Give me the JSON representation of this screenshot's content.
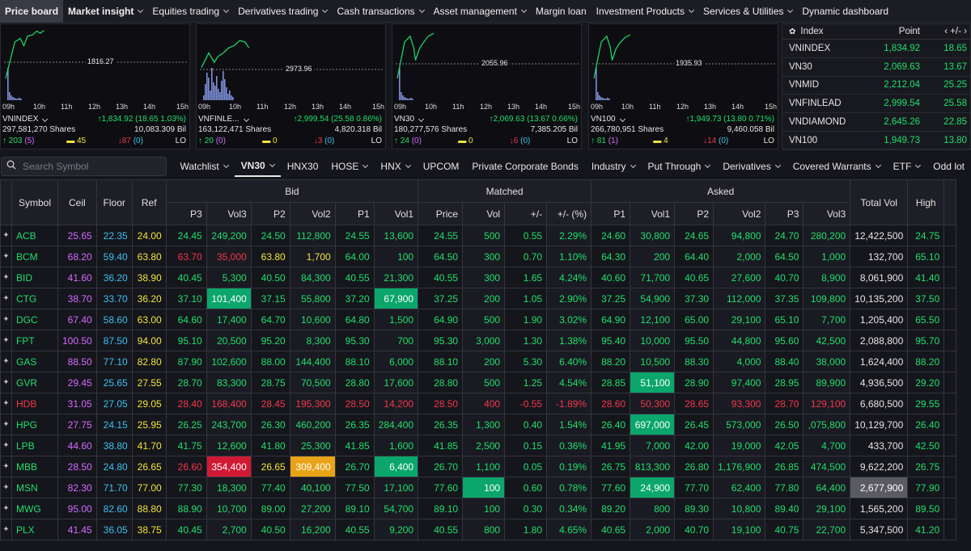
{
  "nav": {
    "items": [
      {
        "label": "Price board",
        "active": true,
        "chevron": false
      },
      {
        "label": "Market insight",
        "active": false,
        "chevron": true,
        "bold": true
      },
      {
        "label": "Equities trading",
        "chevron": true
      },
      {
        "label": "Derivatives trading",
        "chevron": true
      },
      {
        "label": "Cash transactions",
        "chevron": true
      },
      {
        "label": "Asset management",
        "chevron": true
      },
      {
        "label": "Margin loan",
        "chevron": false
      },
      {
        "label": "Investment Products",
        "chevron": true
      },
      {
        "label": "Services & Utilities",
        "chevron": true
      },
      {
        "label": "Dynamic dashboard",
        "chevron": false
      }
    ]
  },
  "panels": [
    {
      "name": "VNINDEX",
      "ref": "1816.27",
      "change": "1,834.92 (18.65 1.03%)",
      "shares": "297,581,270 Shares",
      "value": "10,083.309 Bil",
      "up": "203",
      "up_ceil": "(5)",
      "flat": "45",
      "down": "87",
      "down_floor": "(0)",
      "status": "LO",
      "times": [
        "09h",
        "10h",
        "11h",
        "12h",
        "13h",
        "14h",
        "15h"
      ]
    },
    {
      "name": "VNFINLE...",
      "ref": "2973.96",
      "change": "2,999.54 (25.58 0.86%)",
      "shares": "163,122,471 Shares",
      "value": "4,820.318 Bil",
      "up": "20",
      "up_ceil": "(0)",
      "flat": "0",
      "down": "3",
      "down_floor": "(0)",
      "status": "LO",
      "times": [
        "09h",
        "10h",
        "11h",
        "12h",
        "13h",
        "14h",
        "15h"
      ]
    },
    {
      "name": "VN30",
      "ref": "2055.96",
      "change": "2,069.63 (13.67 0.66%)",
      "shares": "180,277,576 Shares",
      "value": "7,385.205 Bil",
      "up": "24",
      "up_ceil": "(0)",
      "flat": "0",
      "down": "6",
      "down_floor": "(0)",
      "status": "LO",
      "times": [
        "09h",
        "10h",
        "11h",
        "12h",
        "13h",
        "14h",
        "15h"
      ]
    },
    {
      "name": "VN100",
      "ref": "1935.93",
      "change": "1,949.73 (13.80 0.71%)",
      "shares": "266,780,951 Shares",
      "value": "9,460.058 Bil",
      "up": "81",
      "up_ceil": "(1)",
      "flat": "4",
      "down": "14",
      "down_floor": "(0)",
      "status": "LO",
      "times": [
        "09h",
        "10h",
        "11h",
        "12h",
        "13h",
        "14h",
        "15h"
      ]
    }
  ],
  "index_table": {
    "headers": {
      "index": "Index",
      "point": "Point",
      "change": "+/-"
    },
    "rows": [
      {
        "name": "VNINDEX",
        "point": "1,834.92",
        "change": "18.65"
      },
      {
        "name": "VN30",
        "point": "2,069.63",
        "change": "13.67"
      },
      {
        "name": "VNMID",
        "point": "2,212.04",
        "change": "25.25"
      },
      {
        "name": "VNFINLEAD",
        "point": "2,999.54",
        "change": "25.58"
      },
      {
        "name": "VNDIAMOND",
        "point": "2,645.26",
        "change": "22.85"
      },
      {
        "name": "VN100",
        "point": "1,949.73",
        "change": "13.80"
      }
    ]
  },
  "search": {
    "placeholder": "Search Symbol"
  },
  "tabs": [
    {
      "label": "Watchlist",
      "chevron": true
    },
    {
      "label": "VN30",
      "chevron": true,
      "active": true
    },
    {
      "label": "HNX30",
      "chevron": false
    },
    {
      "label": "HOSE",
      "chevron": true
    },
    {
      "label": "HNX",
      "chevron": true
    },
    {
      "label": "UPCOM",
      "chevron": false
    },
    {
      "label": "Private Corporate Bonds",
      "chevron": false
    },
    {
      "label": "Industry",
      "chevron": true
    },
    {
      "label": "Put Through",
      "chevron": true
    },
    {
      "label": "Derivatives",
      "chevron": true
    },
    {
      "label": "Covered Warrants",
      "chevron": true
    },
    {
      "label": "ETF",
      "chevron": true
    },
    {
      "label": "Odd lot",
      "chevron": false
    }
  ],
  "table": {
    "headers": {
      "symbol": "Symbol",
      "ceil": "Ceil",
      "floor": "Floor",
      "ref": "Ref",
      "bid": "Bid",
      "matched": "Matched",
      "asked": "Asked",
      "total": "Total Vol",
      "high": "High",
      "sub": [
        "P3",
        "Vol3",
        "P2",
        "Vol2",
        "P1",
        "Vol1",
        "Price",
        "Vol",
        "+/-",
        "+/- (%)",
        "P1",
        "Vol1",
        "P2",
        "Vol2",
        "P3",
        "Vol3"
      ]
    },
    "colors": {
      "up": "#1ee06d",
      "down": "#f2374b",
      "ref": "#f1e53a",
      "ceil": "#d36cff",
      "floor": "#38c3f0"
    },
    "rows": [
      {
        "sym": "ACB",
        "c": "up",
        "ceil": "25.65",
        "floor": "22.35",
        "ref": "24.00",
        "b3": "24.45",
        "bv3": "249,200",
        "b2": "24.50",
        "bv2": "112,800",
        "b1": "24.55",
        "bv1": "13,600",
        "mp": "24.55",
        "mv": "500",
        "ch": "0.55",
        "pct": "2.29%",
        "a1": "24.60",
        "av1": "30,800",
        "a2": "24.65",
        "av2": "94,800",
        "a3": "24.70",
        "av3": "280,200",
        "tv": "12,422,500",
        "hi": "24.75",
        "hl": {}
      },
      {
        "sym": "BCM",
        "c": "up",
        "ceil": "68.20",
        "floor": "59.40",
        "ref": "63.80",
        "b3": "63.70",
        "bv3": "35,000",
        "b2": "63.80",
        "bv2": "1,700",
        "b1": "64.00",
        "bv1": "100",
        "mp": "64.50",
        "mv": "300",
        "ch": "0.70",
        "pct": "1.10%",
        "a1": "64.30",
        "av1": "200",
        "a2": "64.40",
        "av2": "2,000",
        "a3": "64.50",
        "av3": "1,000",
        "tv": "132,700",
        "hi": "65.10",
        "cc": {
          "b3": "down",
          "bv3": "down",
          "b2": "ref",
          "bv2": "ref"
        },
        "hl": {}
      },
      {
        "sym": "BID",
        "c": "up",
        "ceil": "41.60",
        "floor": "36.20",
        "ref": "38.90",
        "b3": "40.45",
        "bv3": "5,300",
        "b2": "40.50",
        "bv2": "84,300",
        "b1": "40.55",
        "bv1": "21,300",
        "mp": "40.55",
        "mv": "300",
        "ch": "1.65",
        "pct": "4.24%",
        "a1": "40.60",
        "av1": "71,700",
        "a2": "40.65",
        "av2": "27,600",
        "a3": "40.70",
        "av3": "8,900",
        "tv": "8,061,900",
        "hi": "41.40",
        "hl": {}
      },
      {
        "sym": "CTG",
        "c": "up",
        "ceil": "38.70",
        "floor": "33.70",
        "ref": "36.20",
        "b3": "37.10",
        "bv3": "101,400",
        "b2": "37.15",
        "bv2": "55,800",
        "b1": "37.20",
        "bv1": "67,900",
        "mp": "37.25",
        "mv": "200",
        "ch": "1.05",
        "pct": "2.90%",
        "a1": "37.25",
        "av1": "54,900",
        "a2": "37.30",
        "av2": "112,000",
        "a3": "37.35",
        "av3": "109,800",
        "tv": "10,135,200",
        "hi": "37.50",
        "hl": {
          "bv3": "green",
          "bv1": "green"
        }
      },
      {
        "sym": "DGC",
        "c": "up",
        "ceil": "67.40",
        "floor": "58.60",
        "ref": "63.00",
        "b3": "64.60",
        "bv3": "17,400",
        "b2": "64.70",
        "bv2": "10,600",
        "b1": "64.80",
        "bv1": "1,500",
        "mp": "64.90",
        "mv": "500",
        "ch": "1.90",
        "pct": "3.02%",
        "a1": "64.90",
        "av1": "12,100",
        "a2": "65.00",
        "av2": "29,100",
        "a3": "65.10",
        "av3": "7,700",
        "tv": "1,205,400",
        "hi": "65.50",
        "hl": {}
      },
      {
        "sym": "FPT",
        "c": "up",
        "ceil": "100.50",
        "floor": "87.50",
        "ref": "94.00",
        "b3": "95.10",
        "bv3": "20,500",
        "b2": "95.20",
        "bv2": "8,300",
        "b1": "95.30",
        "bv1": "700",
        "mp": "95.30",
        "mv": "3,000",
        "ch": "1.30",
        "pct": "1.38%",
        "a1": "95.40",
        "av1": "10,000",
        "a2": "95.50",
        "av2": "44,800",
        "a3": "95.60",
        "av3": "42,500",
        "tv": "2,088,800",
        "hi": "95.70",
        "hl": {}
      },
      {
        "sym": "GAS",
        "c": "up",
        "ceil": "88.50",
        "floor": "77.10",
        "ref": "82.80",
        "b3": "87.90",
        "bv3": "102,600",
        "b2": "88.00",
        "bv2": "144,400",
        "b1": "88.10",
        "bv1": "6,000",
        "mp": "88.10",
        "mv": "200",
        "ch": "5.30",
        "pct": "6.40%",
        "a1": "88.20",
        "av1": "10,500",
        "a2": "88.30",
        "av2": "4,000",
        "a3": "88.40",
        "av3": "38,000",
        "tv": "1,624,400",
        "hi": "88.20",
        "hl": {}
      },
      {
        "sym": "GVR",
        "c": "up",
        "ceil": "29.45",
        "floor": "25.65",
        "ref": "27.55",
        "b3": "28.70",
        "bv3": "83,300",
        "b2": "28.75",
        "bv2": "70,500",
        "b1": "28.80",
        "bv1": "17,600",
        "mp": "28.80",
        "mv": "500",
        "ch": "1.25",
        "pct": "4.54%",
        "a1": "28.85",
        "av1": "51,100",
        "a2": "28.90",
        "av2": "97,400",
        "a3": "28.95",
        "av3": "89,900",
        "tv": "4,936,500",
        "hi": "29.20",
        "hl": {
          "av1": "green"
        }
      },
      {
        "sym": "HDB",
        "c": "down",
        "ceil": "31.05",
        "floor": "27.05",
        "ref": "29.05",
        "b3": "28.40",
        "bv3": "168,400",
        "b2": "28.45",
        "bv2": "195,300",
        "b1": "28.50",
        "bv1": "14,200",
        "mp": "28.50",
        "mv": "400",
        "ch": "-0.55",
        "pct": "-1.89%",
        "a1": "28.60",
        "av1": "50,300",
        "a2": "28.65",
        "av2": "93,300",
        "a3": "28.70",
        "av3": "129,100",
        "tv": "6,680,500",
        "hi": "29.55",
        "hl": {}
      },
      {
        "sym": "HPG",
        "c": "up",
        "ceil": "27.75",
        "floor": "24.15",
        "ref": "25.95",
        "b3": "26.25",
        "bv3": "243,700",
        "b2": "26.30",
        "bv2": "460,200",
        "b1": "26.35",
        "bv1": "284,400",
        "mp": "26.35",
        "mv": "1,300",
        "ch": "0.40",
        "pct": "1.54%",
        "a1": "26.40",
        "av1": "697,000",
        "a2": "26.45",
        "av2": "573,000",
        "a3": "26.50",
        "av3": ",075,800",
        "tv": "10,129,700",
        "hi": "26.40",
        "hl": {
          "av1": "green"
        }
      },
      {
        "sym": "LPB",
        "c": "up",
        "ceil": "44.60",
        "floor": "38.80",
        "ref": "41.70",
        "b3": "41.75",
        "bv3": "12,600",
        "b2": "41.80",
        "bv2": "25,300",
        "b1": "41.85",
        "bv1": "1,600",
        "mp": "41.85",
        "mv": "2,500",
        "ch": "0.15",
        "pct": "0.36%",
        "a1": "41.95",
        "av1": "7,000",
        "a2": "42.00",
        "av2": "19,000",
        "a3": "42.05",
        "av3": "4,700",
        "tv": "433,700",
        "hi": "42.50",
        "hl": {}
      },
      {
        "sym": "MBB",
        "c": "up",
        "ceil": "28.50",
        "floor": "24.80",
        "ref": "26.65",
        "b3": "26.60",
        "bv3": "354,400",
        "b2": "26.65",
        "bv2": "309,400",
        "b1": "26.70",
        "bv1": "6,400",
        "mp": "26.70",
        "mv": "1,100",
        "ch": "0.05",
        "pct": "0.19%",
        "a1": "26.75",
        "av1": "813,300",
        "a2": "26.80",
        "av2": "1,176,900",
        "a3": "26.85",
        "av3": "474,500",
        "tv": "9,622,200",
        "hi": "26.75",
        "cc": {
          "b3": "down",
          "b2": "ref"
        },
        "hl": {
          "bv3": "red",
          "bv2": "orange",
          "bv1": "green"
        }
      },
      {
        "sym": "MSN",
        "c": "up",
        "ceil": "82.30",
        "floor": "71.70",
        "ref": "77.00",
        "b3": "77.30",
        "bv3": "18,300",
        "b2": "77.40",
        "bv2": "40,100",
        "b1": "77.50",
        "bv1": "17,100",
        "mp": "77.60",
        "mv": "100",
        "ch": "0.60",
        "pct": "0.78%",
        "a1": "77.60",
        "av1": "24,900",
        "a2": "77.70",
        "av2": "62,400",
        "a3": "77.80",
        "av3": "64,400",
        "tv": "2,677,900",
        "hi": "77.90",
        "hl": {
          "mv": "green",
          "av1": "green",
          "tv": "gray"
        }
      },
      {
        "sym": "MWG",
        "c": "up",
        "ceil": "95.00",
        "floor": "82.60",
        "ref": "88.80",
        "b3": "88.90",
        "bv3": "10,700",
        "b2": "89.00",
        "bv2": "27,200",
        "b1": "89.10",
        "bv1": "54,700",
        "mp": "89.10",
        "mv": "100",
        "ch": "0.30",
        "pct": "0.34%",
        "a1": "89.20",
        "av1": "800",
        "a2": "89.30",
        "av2": "10,800",
        "a3": "89.40",
        "av3": "29,100",
        "tv": "1,565,200",
        "hi": "89.50",
        "hl": {}
      },
      {
        "sym": "PLX",
        "c": "up",
        "ceil": "41.45",
        "floor": "36.05",
        "ref": "38.75",
        "b3": "40.45",
        "bv3": "2,700",
        "b2": "40.50",
        "bv2": "16,200",
        "b1": "40.55",
        "bv1": "9,200",
        "mp": "40.55",
        "mv": "800",
        "ch": "1.80",
        "pct": "4.65%",
        "a1": "40.65",
        "av1": "2,000",
        "a2": "40.70",
        "av2": "19,100",
        "a3": "40.75",
        "av3": "22,700",
        "tv": "5,347,500",
        "hi": "41.20",
        "hl": {}
      }
    ]
  }
}
